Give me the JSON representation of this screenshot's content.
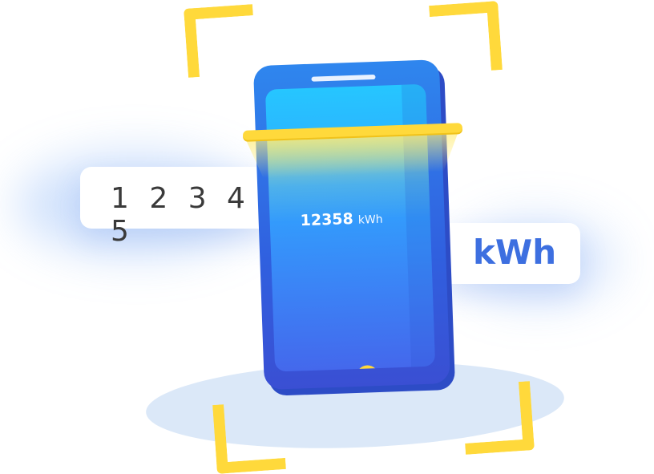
{
  "meter_card": {
    "digits": "1 2 3 4 5"
  },
  "unit_card": {
    "unit": "kWh"
  },
  "phone": {
    "reading_value": "12358",
    "reading_unit": "kWh"
  },
  "colors": {
    "accent_yellow": "#ffd93b",
    "phone_blue": "#3060df",
    "screen_cyan": "#26c6ff",
    "unit_text_blue": "#3d6fe0"
  },
  "icons": [
    "scan-frame-corner-icon",
    "scan-line-icon",
    "home-button-icon"
  ]
}
